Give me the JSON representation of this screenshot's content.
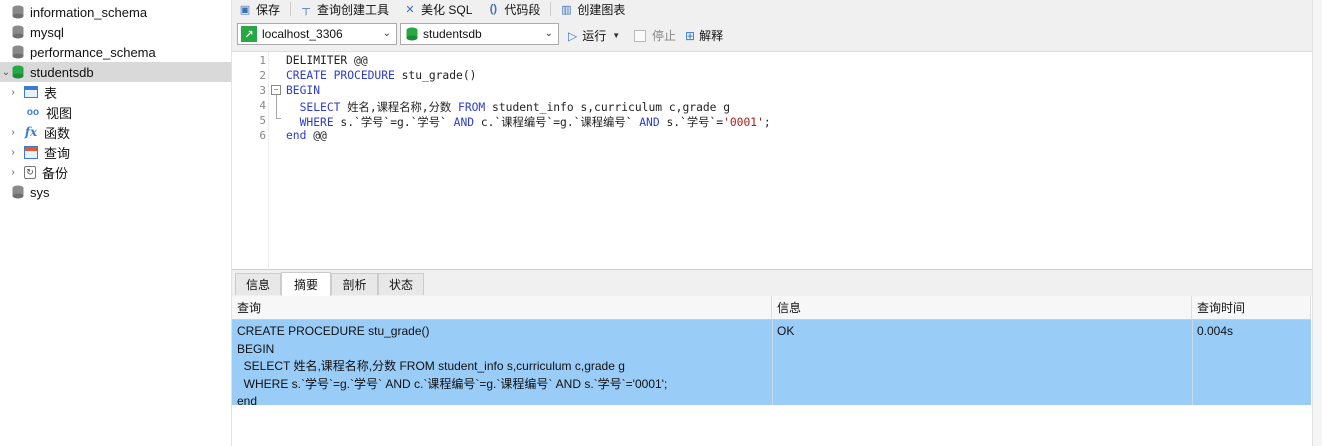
{
  "sidebar": {
    "items": [
      {
        "label": "information_schema",
        "icon": "database-icon"
      },
      {
        "label": "mysql",
        "icon": "database-icon"
      },
      {
        "label": "performance_schema",
        "icon": "database-icon"
      },
      {
        "label": "studentsdb",
        "icon": "database-green-icon",
        "expanded": true,
        "selected": true
      },
      {
        "label": "表",
        "icon": "table-icon"
      },
      {
        "label": "视图",
        "icon": "view-icon"
      },
      {
        "label": "函数",
        "icon": "function-icon"
      },
      {
        "label": "查询",
        "icon": "query-icon"
      },
      {
        "label": "备份",
        "icon": "backup-icon"
      },
      {
        "label": "sys",
        "icon": "database-icon"
      }
    ]
  },
  "toolbar": {
    "save": "保存",
    "query_builder": "查询创建工具",
    "beautify": "美化 SQL",
    "snippet": "代码段",
    "create_chart": "创建图表"
  },
  "connection": {
    "server": "localhost_3306",
    "database": "studentsdb",
    "run": "运行",
    "stop": "停止",
    "explain": "解释"
  },
  "editor": {
    "line_numbers": [
      "1",
      "2",
      "3",
      "4",
      "5",
      "6"
    ],
    "lines": [
      [
        {
          "t": "DELIMITER @@",
          "c": ""
        }
      ],
      [
        {
          "t": "CREATE PROCEDURE",
          "c": "kw"
        },
        {
          "t": " stu_grade()",
          "c": ""
        }
      ],
      [
        {
          "t": "BEGIN",
          "c": "kw"
        }
      ],
      [
        {
          "t": "  ",
          "c": ""
        },
        {
          "t": "SELECT",
          "c": "kw"
        },
        {
          "t": " 姓名,课程名称,分数 ",
          "c": ""
        },
        {
          "t": "FROM",
          "c": "kw"
        },
        {
          "t": " student_info s,curriculum c,grade g",
          "c": ""
        }
      ],
      [
        {
          "t": "  ",
          "c": ""
        },
        {
          "t": "WHERE",
          "c": "kw"
        },
        {
          "t": " s.`学号`=g.`学号` ",
          "c": ""
        },
        {
          "t": "AND",
          "c": "kw"
        },
        {
          "t": " c.`课程编号`=g.`课程编号` ",
          "c": ""
        },
        {
          "t": "AND",
          "c": "kw"
        },
        {
          "t": " s.`学号`=",
          "c": ""
        },
        {
          "t": "'0001'",
          "c": "str"
        },
        {
          "t": ";",
          "c": ""
        }
      ],
      [
        {
          "t": "end",
          "c": "kw"
        },
        {
          "t": " @@",
          "c": ""
        }
      ]
    ]
  },
  "result_tabs": [
    "信息",
    "摘要",
    "剖析",
    "状态"
  ],
  "result_active_tab": "摘要",
  "result_table": {
    "columns": [
      "查询",
      "信息",
      "查询时间"
    ],
    "rows": [
      {
        "query": "CREATE PROCEDURE stu_grade()\nBEGIN\n  SELECT 姓名,课程名称,分数 FROM student_info s,curriculum c,grade g\n  WHERE s.`学号`=g.`学号` AND c.`课程编号`=g.`课程编号` AND s.`学号`='0001';\nend",
        "info": "OK",
        "time": "0.004s"
      }
    ]
  },
  "colors": {
    "keyword": "#2c3ccf",
    "string": "#b11a1a",
    "selection": "#99ccf7",
    "db_green": "#27a844"
  }
}
